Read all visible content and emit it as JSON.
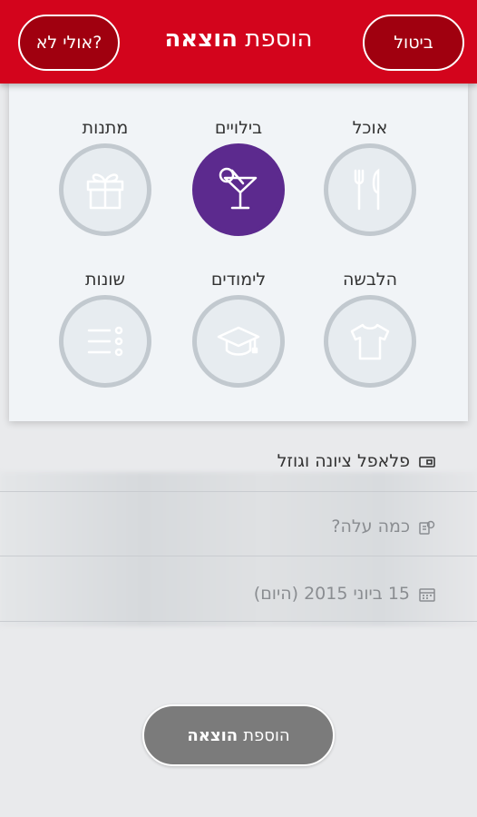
{
  "header": {
    "cancel_label": "ביטול",
    "maybe_not_label": "אולי לא?",
    "title_regular": "הוספת",
    "title_bold": "הוצאה"
  },
  "categories": [
    {
      "label": "אוכל",
      "icon": "fork-knife-icon",
      "selected": false
    },
    {
      "label": "בילויים",
      "icon": "cocktail-icon",
      "selected": true
    },
    {
      "label": "מתנות",
      "icon": "gift-icon",
      "selected": false
    },
    {
      "label": "הלבשה",
      "icon": "shirt-icon",
      "selected": false
    },
    {
      "label": "לימודים",
      "icon": "graduation-cap-icon",
      "selected": false
    },
    {
      "label": "שונות",
      "icon": "list-icon",
      "selected": false
    }
  ],
  "form": {
    "description_value": "פלאפל ציונה וגוזל",
    "amount_placeholder": "כמה עלה?",
    "date_value": "15 ביוני 2015 (היום)"
  },
  "add_button": {
    "label_regular": "הוספת",
    "label_bold": "הוצאה"
  },
  "colors": {
    "header_red": "#d3041c",
    "selected_purple": "#5c2a8e",
    "button_gray": "#7b7b7b"
  }
}
